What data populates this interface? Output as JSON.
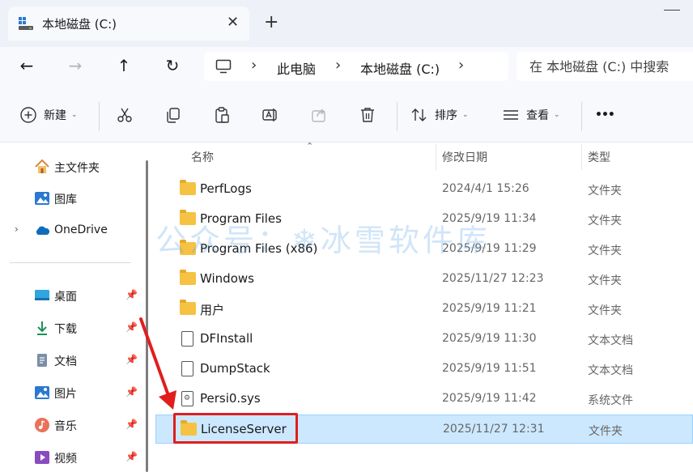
{
  "tab": {
    "title": "本地磁盘 (C:)",
    "close_icon": "✕",
    "new_tab_icon": "+"
  },
  "nav": {
    "back_icon": "←",
    "forward_icon": "→",
    "up_icon": "↑",
    "refresh_icon": "↻"
  },
  "address": {
    "breadcrumb": [
      "此电脑",
      "本地磁盘 (C:)"
    ],
    "separator": "›"
  },
  "search": {
    "placeholder": "在 本地磁盘 (C:) 中搜索"
  },
  "toolbar": {
    "new_label": "新建",
    "sort_label": "排序",
    "view_label": "查看",
    "more_label": "•••"
  },
  "sidebar": {
    "items": [
      {
        "label": "主文件夹",
        "icon": "home-icon"
      },
      {
        "label": "图库",
        "icon": "gallery-icon"
      },
      {
        "label": "OneDrive",
        "icon": "cloud-icon"
      },
      {
        "label": "桌面",
        "icon": "desktop-icon"
      },
      {
        "label": "下载",
        "icon": "download-icon"
      },
      {
        "label": "文档",
        "icon": "document-icon"
      },
      {
        "label": "图片",
        "icon": "pictures-icon"
      },
      {
        "label": "音乐",
        "icon": "music-icon"
      },
      {
        "label": "视频",
        "icon": "video-icon"
      }
    ],
    "pin_icon": "📌",
    "expander": "›"
  },
  "columns": {
    "name": "名称",
    "modified": "修改日期",
    "type": "类型"
  },
  "files": [
    {
      "name": "PerfLogs",
      "modified": "2024/4/1 15:26",
      "type": "文件夹",
      "kind": "folder"
    },
    {
      "name": "Program Files",
      "modified": "2025/9/19 11:34",
      "type": "文件夹",
      "kind": "folder"
    },
    {
      "name": "Program Files (x86)",
      "modified": "2025/9/19 11:29",
      "type": "文件夹",
      "kind": "folder"
    },
    {
      "name": "Windows",
      "modified": "2025/11/27 12:23",
      "type": "文件夹",
      "kind": "folder"
    },
    {
      "name": "用户",
      "modified": "2025/9/19 11:21",
      "type": "文件夹",
      "kind": "folder"
    },
    {
      "name": "DFInstall",
      "modified": "2025/9/19 11:30",
      "type": "文本文档",
      "kind": "doc"
    },
    {
      "name": "DumpStack",
      "modified": "2025/9/19 11:51",
      "type": "文本文档",
      "kind": "doc"
    },
    {
      "name": "Persi0.sys",
      "modified": "2025/9/19 11:42",
      "type": "系统文件",
      "kind": "sysdoc"
    },
    {
      "name": "LicenseServer",
      "modified": "2025/11/27 12:31",
      "type": "文件夹",
      "kind": "folder",
      "selected": true
    }
  ],
  "watermark": "公众号：❄冰雪软件库",
  "colors": {
    "accent": "#0067c0",
    "selection": "#cce8ff",
    "annotation": "#e01e1e",
    "folder": "#f6c243"
  }
}
